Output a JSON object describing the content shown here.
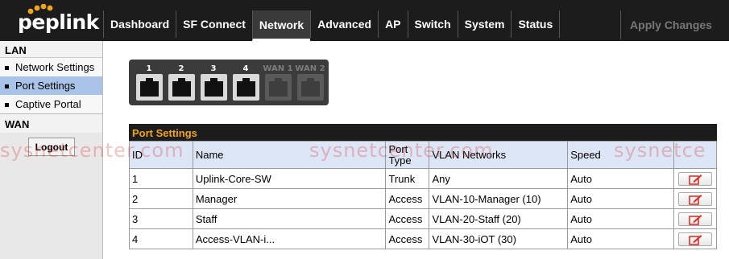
{
  "brand": {
    "name": "peplink"
  },
  "nav": {
    "items": [
      {
        "label": "Dashboard"
      },
      {
        "label": "SF Connect"
      },
      {
        "label": "Network"
      },
      {
        "label": "Advanced"
      },
      {
        "label": "AP"
      },
      {
        "label": "Switch"
      },
      {
        "label": "System"
      },
      {
        "label": "Status"
      }
    ],
    "active": "Network",
    "apply_label": "Apply Changes"
  },
  "sidebar": {
    "lan_heading": "LAN",
    "items": [
      {
        "label": "Network Settings"
      },
      {
        "label": "Port Settings"
      },
      {
        "label": "Captive Portal"
      }
    ],
    "active": "Port Settings",
    "wan_heading": "WAN",
    "logout_label": "Logout"
  },
  "ports": [
    {
      "label": "1",
      "state": "up"
    },
    {
      "label": "2",
      "state": "up"
    },
    {
      "label": "3",
      "state": "up"
    },
    {
      "label": "4",
      "state": "up"
    },
    {
      "label": "WAN 1",
      "state": "off"
    },
    {
      "label": "WAN 2",
      "state": "off"
    }
  ],
  "port_settings": {
    "title": "Port Settings",
    "headers": {
      "id": "ID",
      "name": "Name",
      "port_type": "Port Type",
      "vlan": "VLAN Networks",
      "speed": "Speed"
    },
    "rows": [
      {
        "id": "1",
        "name": "Uplink-Core-SW",
        "port_type": "Trunk",
        "vlan": "Any",
        "speed": "Auto"
      },
      {
        "id": "2",
        "name": "Manager",
        "port_type": "Access",
        "vlan": "VLAN-10-Manager (10)",
        "speed": "Auto"
      },
      {
        "id": "3",
        "name": "Staff",
        "port_type": "Access",
        "vlan": "VLAN-20-Staff (20)",
        "speed": "Auto"
      },
      {
        "id": "4",
        "name": "Access-VLAN-i...",
        "port_type": "Access",
        "vlan": "VLAN-30-iOT (30)",
        "speed": "Auto"
      }
    ]
  },
  "watermark": {
    "segments": [
      "sysnetcenter.com",
      "sysnetcenter.com",
      "sysnetce"
    ]
  },
  "colors": {
    "topbar": "#1c1c1c",
    "title_accent": "#f1a51a",
    "active_sidebar": "#a9c4e8",
    "table_header": "#dce6f7",
    "edit_icon": "#d9342b",
    "watermark": "#dc2828"
  },
  "icons": {
    "edit": "edit-icon",
    "port": "ethernet-port-icon"
  }
}
